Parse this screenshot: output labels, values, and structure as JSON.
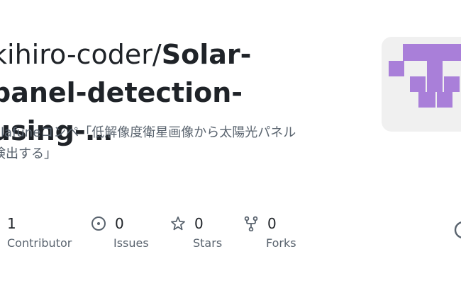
{
  "header": {
    "owner": "kihiro-coder/",
    "repo_line1": "Solar-",
    "repo_line2": "panel-detection-using-…"
  },
  "description": {
    "line1": "olafuneコンペ「低解像度衛星画像から太陽光パネル",
    "line2": "検出する」"
  },
  "stats": [
    {
      "icon": "people-icon",
      "value": "1",
      "label": "Contributor"
    },
    {
      "icon": "issue-icon",
      "value": "0",
      "label": "Issues"
    },
    {
      "icon": "star-icon",
      "value": "0",
      "label": "Stars"
    },
    {
      "icon": "fork-icon",
      "value": "0",
      "label": "Forks"
    }
  ],
  "avatar": {
    "icon": "identicon",
    "color": "#a97fd9",
    "background": "#f0f0f0"
  },
  "colors": {
    "text": "#1f2328",
    "muted": "#59636e"
  }
}
